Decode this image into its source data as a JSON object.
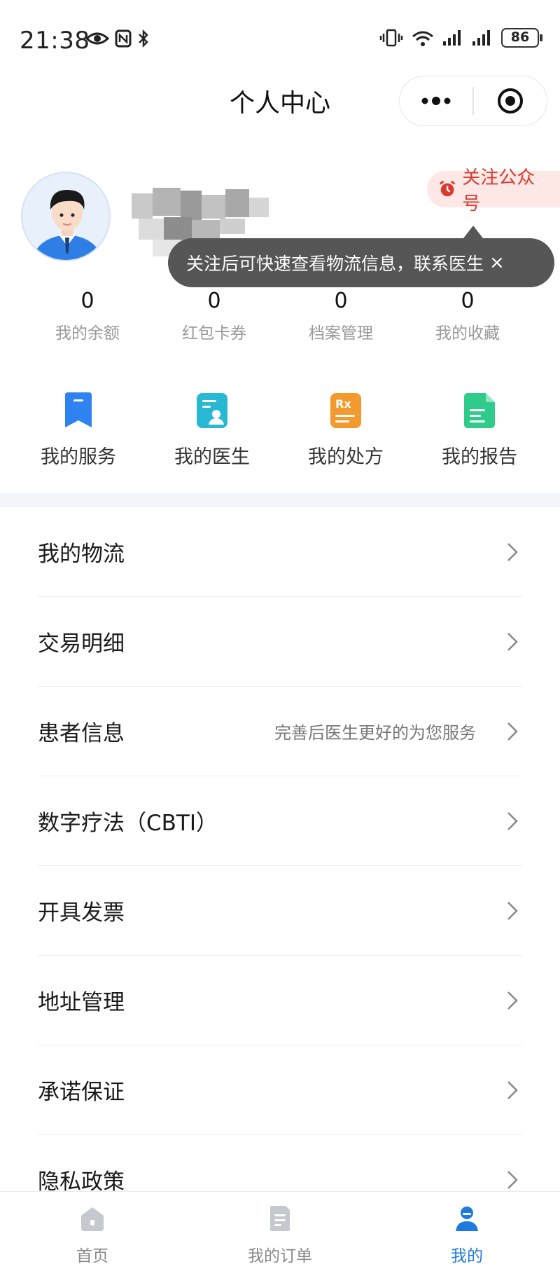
{
  "status_bar": {
    "time": "21:38",
    "battery": "86"
  },
  "nav": {
    "title": "个人中心"
  },
  "follow": {
    "badge_label": "关注公众号",
    "tooltip": "关注后可快速查看物流信息，联系医生",
    "tooltip_close": "×"
  },
  "stats": [
    {
      "value": "0",
      "label": "我的余额"
    },
    {
      "value": "0",
      "label": "红包卡券"
    },
    {
      "value": "0",
      "label": "档案管理"
    },
    {
      "value": "0",
      "label": "我的收藏"
    }
  ],
  "services": [
    {
      "label": "我的服务",
      "icon": "bookmark-icon",
      "color": "#2f83f0"
    },
    {
      "label": "我的医生",
      "icon": "doctor-icon",
      "color": "#28b8d4"
    },
    {
      "label": "我的处方",
      "icon": "prescription-icon",
      "color": "#f29a2e"
    },
    {
      "label": "我的报告",
      "icon": "report-icon",
      "color": "#2fcb8a"
    }
  ],
  "menu": [
    {
      "label": "我的物流",
      "hint": ""
    },
    {
      "label": "交易明细",
      "hint": ""
    },
    {
      "label": "患者信息",
      "hint": "完善后医生更好的为您服务"
    },
    {
      "label": "数字疗法（CBTI）",
      "hint": ""
    },
    {
      "label": "开具发票",
      "hint": ""
    },
    {
      "label": "地址管理",
      "hint": ""
    },
    {
      "label": "承诺保证",
      "hint": ""
    },
    {
      "label": "隐私政策",
      "hint": ""
    }
  ],
  "tabbar": [
    {
      "label": "首页",
      "icon": "home-icon",
      "active": false
    },
    {
      "label": "我的订单",
      "icon": "orders-icon",
      "active": false
    },
    {
      "label": "我的",
      "icon": "profile-icon",
      "active": true
    }
  ],
  "colors": {
    "accent": "#1f7ae0",
    "follow_red": "#d93a2f",
    "section_bg": "#f2f6fb"
  }
}
